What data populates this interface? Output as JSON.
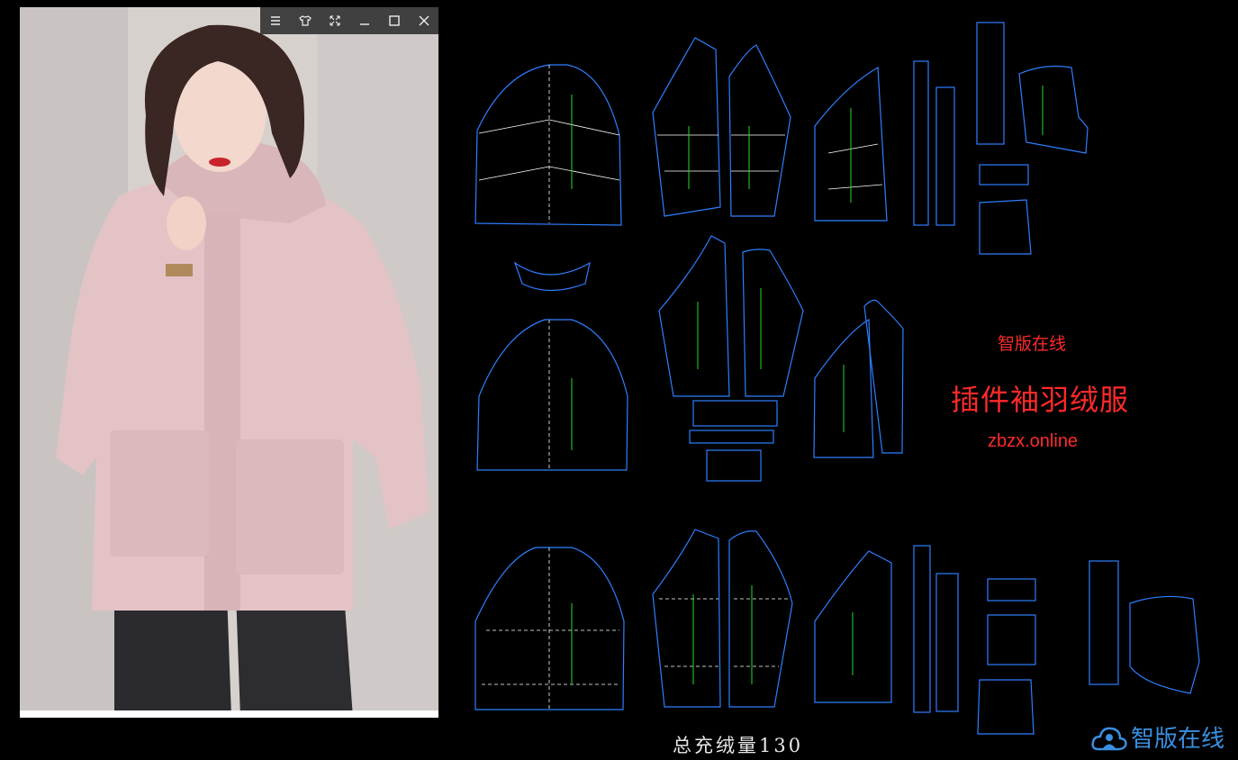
{
  "window": {
    "toolbar": {
      "menu_icon": "menu-icon",
      "shirt_icon": "shirt-icon",
      "fullscreen_icon": "expand-icon",
      "minimize_icon": "minimize-icon",
      "maximize_icon": "maximize-icon",
      "close_icon": "close-icon"
    }
  },
  "photo": {
    "subject": "woman in pink hooded down jacket",
    "jacket_color": "#e3c3c6",
    "background_color": "#d7d1ce"
  },
  "patterns": {
    "outline_color": "#2d7fff",
    "seam_color": "#ffffff",
    "grain_color": "#22dd22"
  },
  "brand": {
    "small_title": "智版在线",
    "product_title": "插件袖羽绒服",
    "url": "zbzx.online",
    "color": "#ff2a2a"
  },
  "fill_note": "总充绒量130",
  "logo": {
    "icon": "cloud-person-icon",
    "text": "智版在线",
    "color": "#3a8fe0"
  }
}
